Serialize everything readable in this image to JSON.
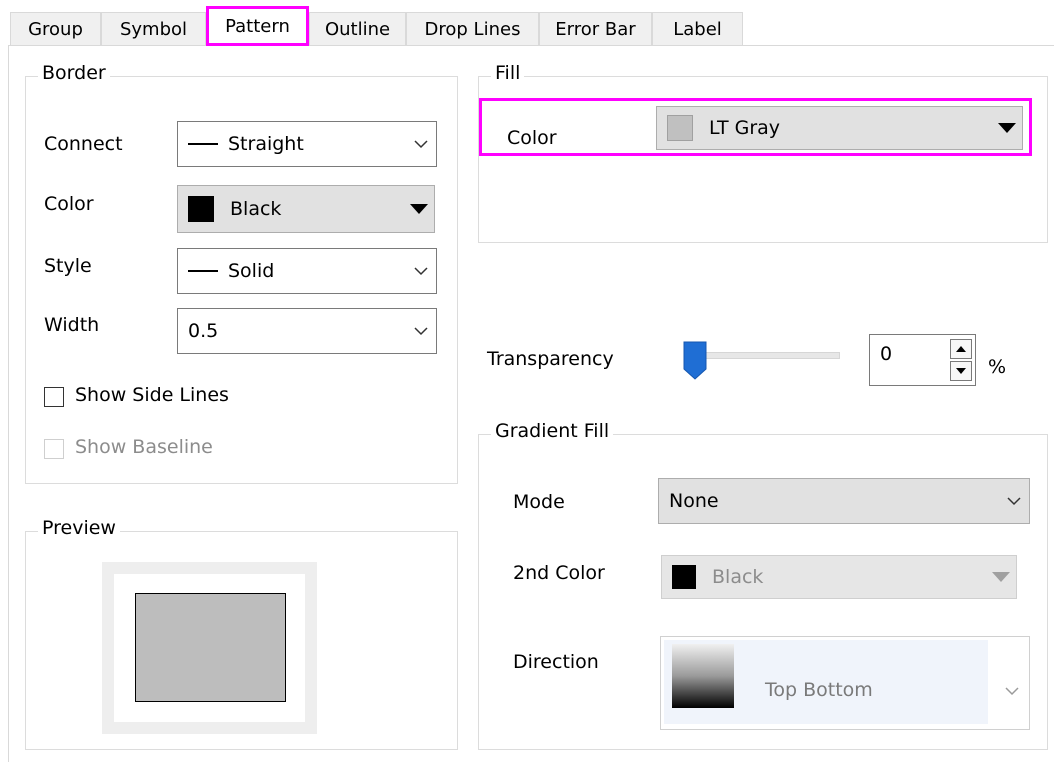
{
  "tabs": [
    "Group",
    "Symbol",
    "Pattern",
    "Outline",
    "Drop Lines",
    "Error Bar",
    "Label"
  ],
  "active_tab": "Pattern",
  "border": {
    "title": "Border",
    "connect_label": "Connect",
    "connect_value": "Straight",
    "color_label": "Color",
    "color_value": "Black",
    "style_label": "Style",
    "style_value": "Solid",
    "width_label": "Width",
    "width_value": "0.5",
    "show_side_lines": "Show Side Lines",
    "show_baseline": "Show Baseline"
  },
  "preview": {
    "title": "Preview",
    "fill_color": "#bdbdbd"
  },
  "fill": {
    "title": "Fill",
    "color_label": "Color",
    "color_value": "LT Gray",
    "swatch": "#c0c0c0"
  },
  "transparency": {
    "label": "Transparency",
    "value": "0",
    "unit": "%",
    "level_percent": 0
  },
  "gradient": {
    "title": "Gradient Fill",
    "mode_label": "Mode",
    "mode_value": "None",
    "second_color_label": "2nd Color",
    "second_color_value": "Black",
    "direction_label": "Direction",
    "direction_value": "Top Bottom"
  },
  "colors": {
    "highlight": "#ff00ff",
    "black": "#000000"
  }
}
